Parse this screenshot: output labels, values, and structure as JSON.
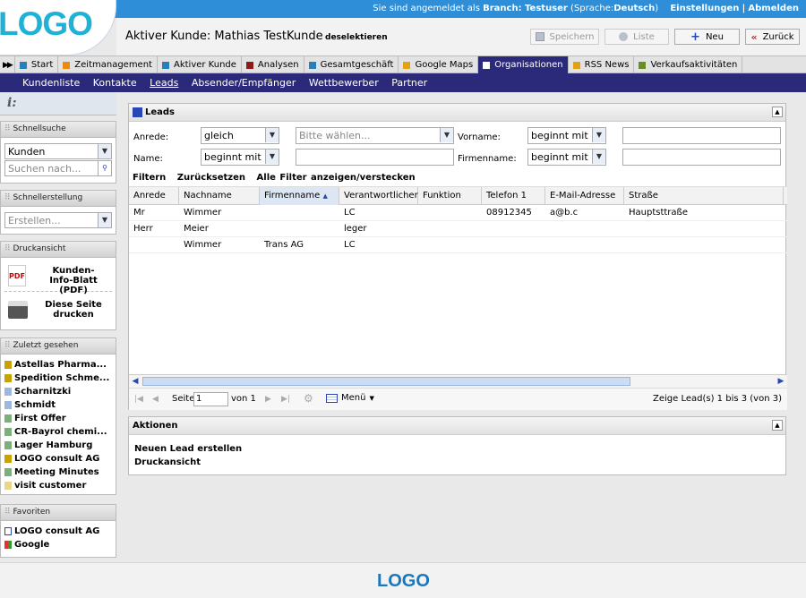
{
  "topbar": {
    "logged_in_prefix": "Sie sind angemeldet als",
    "branch": "Branch: Testuser",
    "lang_prefix": "(Sprache:",
    "lang": "Deutsch",
    "lang_suffix": ")",
    "settings": "Einstellungen",
    "separator": "|",
    "logout": "Abmelden"
  },
  "logo": "LOGO",
  "header": {
    "active_customer": "Aktiver Kunde: Mathias TestKunde",
    "deselect": "deselektieren",
    "save": "Speichern",
    "list": "Liste",
    "new": "Neu",
    "back": "Zurück"
  },
  "tabs": [
    {
      "label": "Start",
      "color": "#2a7fb8"
    },
    {
      "label": "Zeitmanagement",
      "color": "#e98a17"
    },
    {
      "label": "Aktiver Kunde",
      "color": "#2a7fb8"
    },
    {
      "label": "Analysen",
      "color": "#8b1a1a"
    },
    {
      "label": "Gesamtgeschäft",
      "color": "#2a7fb8"
    },
    {
      "label": "Google Maps",
      "color": "#e0a316"
    },
    {
      "label": "Organisationen",
      "color": "#ffffff"
    },
    {
      "label": "RSS News",
      "color": "#e0a316"
    },
    {
      "label": "Verkaufsaktivitäten",
      "color": "#6b8e23"
    }
  ],
  "subnav": [
    "Kundenliste",
    "Kontakte",
    "Leads",
    "Absender/Empfänger",
    "Wettbewerber",
    "Partner"
  ],
  "sidebar": {
    "info_glyph": "i:",
    "quicksearch": {
      "title": "Schnellsuche",
      "type": "Kunden",
      "placeholder": "Suchen nach..."
    },
    "quickcreate": {
      "title": "Schnellerstellung",
      "placeholder": "Erstellen..."
    },
    "print": {
      "title": "Druckansicht",
      "pdf": "Kunden-\nInfo-Blatt (PDF)",
      "page": "Diese Seite\ndrucken"
    },
    "recent": {
      "title": "Zuletzt gesehen",
      "items": [
        "Astellas Pharma...",
        "Spedition Schme...",
        "Scharnitzki",
        "Schmidt",
        "First Offer",
        "CR-Bayrol chemi...",
        "Lager Hamburg",
        "LOGO consult AG",
        "Meeting Minutes",
        "visit customer"
      ]
    },
    "favorites": {
      "title": "Favoriten",
      "items": [
        "LOGO consult AG",
        "Google"
      ]
    }
  },
  "leads": {
    "title": "Leads",
    "filters": {
      "anrede_label": "Anrede:",
      "anrede_op": "gleich",
      "anrede_value": "Bitte wählen...",
      "vorname_label": "Vorname:",
      "vorname_op": "beginnt mit",
      "name_label": "Name:",
      "name_op": "beginnt mit",
      "firmenname_label": "Firmenname:",
      "firmenname_op": "beginnt mit",
      "filter": "Filtern",
      "reset": "Zurücksetzen",
      "toggle": "Alle Filter anzeigen/verstecken"
    },
    "columns": [
      "Anrede",
      "Nachname",
      "Firmenname",
      "Verantwortlicher",
      "Funktion",
      "Telefon 1",
      "E-Mail-Adresse",
      "Straße"
    ],
    "sort_indicator": "▲",
    "rows": [
      [
        "Mr",
        "Wimmer",
        "",
        "LC",
        "",
        "08912345",
        "a@b.c",
        "Hauptsttraße"
      ],
      [
        "Herr",
        "Meier",
        "",
        "leger",
        "",
        "",
        "",
        ""
      ],
      [
        "",
        "Wimmer",
        "Trans AG",
        "LC",
        "",
        "",
        "",
        ""
      ]
    ],
    "pager": {
      "page_label": "Seite",
      "page": "1",
      "of": "von 1",
      "menu": "Menü",
      "summary": "Zeige Lead(s) 1 bis 3 (von 3)"
    }
  },
  "actions": {
    "title": "Aktionen",
    "items": [
      "Neuen Lead erstellen",
      "Druckansicht"
    ]
  },
  "footer_logo": "LOGO"
}
